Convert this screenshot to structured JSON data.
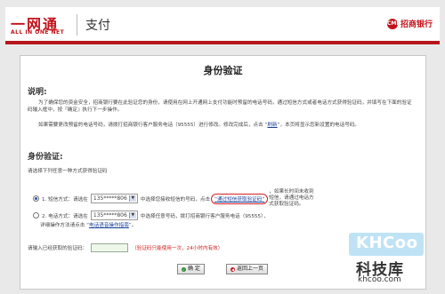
{
  "header": {
    "logo_main": "一网通",
    "logo_sub": "ALL IN ONE NET",
    "section": "支付",
    "bank_name": "招商银行",
    "bank_mark": "CMB"
  },
  "page": {
    "title": "身份验证",
    "intro_heading": "说明:",
    "intro_p1": "为了确保您的资金安全，招商银行要在此验证您的身份，请使用在网上开通网上支付功能时预留的电话号码，通过短信方式或者电话方式获得验证码，并填写在下面的验证码输入框中，按『确定』执行下一步操作。",
    "intro_p2a": "如果需要更改预留的电话号码，请拨打招商银行客户服务电话（95555）进行修改。修改完成后，点击 “",
    "intro_refresh": "刷新",
    "intro_p2b": "”，本页将显示您新设置的电话号码。",
    "verify_heading": "身份验证:",
    "choose_text": "请选择下列任意一种方式获得验证码",
    "opt1_prefix": "1. 短信方式：请选在",
    "opt1_phone": "135*****806",
    "opt1_mid": "中选择您接收短信的号码，点击",
    "opt1_link": "“通过短信获取验证码”",
    "opt1_tail": "，如果长时间未收到短信，请通过电话方式获取验证码。",
    "opt2_prefix": "2. 电话方式：请选在",
    "opt2_phone": "135*****806",
    "opt2_mid": "中选择任意号码，拨打招商银行客户服务电话（95555），",
    "opt2_tail_a": "详细操作方法请点击 “",
    "opt2_link": "电话语音操作指南",
    "opt2_tail_b": "”。",
    "code_label": "请输入已经获取的验证码：",
    "code_value": "",
    "code_note": "（验证码只能使用一次，24小时内有效）",
    "confirm_btn": "确 定",
    "back_btn": "返回上一页"
  },
  "watermark": {
    "logo": "KHCoo",
    "cn": "科技库",
    "url": "khcoo.com"
  },
  "colors": {
    "brand_red": "#c1121a",
    "link_blue": "#1a3f9b"
  }
}
